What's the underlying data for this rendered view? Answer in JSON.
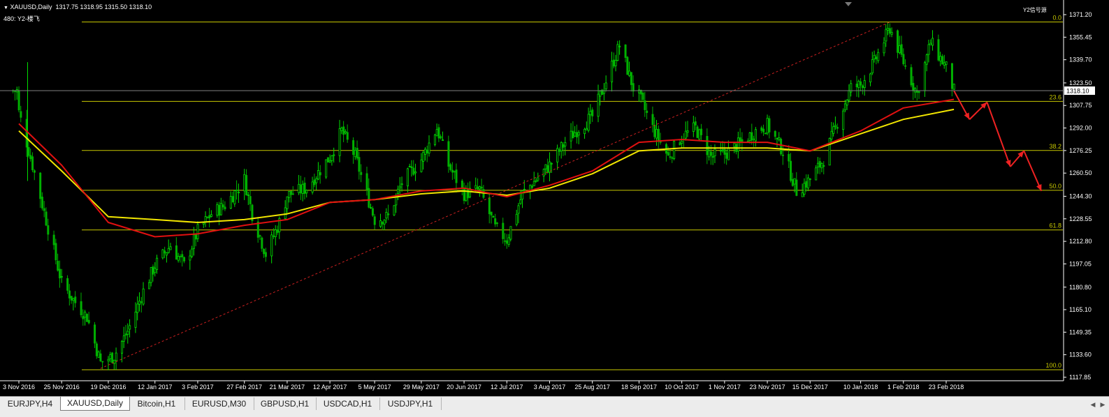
{
  "header": {
    "symbol": "XAUUSD,Daily",
    "ohlc": "1317.75 1318.95 1315.50 1318.10",
    "indicator": "480: Y2-楼飞",
    "signal_label": "Y2信号源"
  },
  "tabs": [
    {
      "label": "EURJPY,H4",
      "active": false
    },
    {
      "label": "XAUUSD,Daily",
      "active": true
    },
    {
      "label": "Bitcoin,H1",
      "active": false
    },
    {
      "label": "EURUSD,M30",
      "active": false
    },
    {
      "label": "GBPUSD,H1",
      "active": false
    },
    {
      "label": "USDCAD,H1",
      "active": false
    },
    {
      "label": "USDJPY,H1",
      "active": false
    }
  ],
  "chart_data": {
    "type": "candlestick",
    "symbol": "XAUUSD",
    "timeframe": "Daily",
    "current_price": "1318.10",
    "y_ticks": [
      "1371.20",
      "1355.45",
      "1339.70",
      "1323.50",
      "1307.75",
      "1292.00",
      "1276.25",
      "1260.50",
      "1244.30",
      "1228.55",
      "1212.80",
      "1197.05",
      "1180.80",
      "1165.10",
      "1149.35",
      "1133.60",
      "1117.85"
    ],
    "ylim": [
      1117.85,
      1371.2
    ],
    "x_ticks": [
      "3 Nov 2016",
      "25 Nov 2016",
      "19 Dec 2016",
      "12 Jan 2017",
      "3 Feb 2017",
      "27 Feb 2017",
      "21 Mar 2017",
      "12 Apr 2017",
      "5 May 2017",
      "29 May 2017",
      "20 Jun 2017",
      "12 Jul 2017",
      "3 Aug 2017",
      "25 Aug 2017",
      "18 Sep 2017",
      "10 Oct 2017",
      "1 Nov 2017",
      "23 Nov 2017",
      "15 Dec 2017",
      "10 Jan 2018",
      "1 Feb 2018",
      "23 Feb 2018"
    ],
    "fib_levels": [
      {
        "label": "0.0",
        "price": 1366.1
      },
      {
        "label": "23.6",
        "price": 1310.6
      },
      {
        "label": "38.2",
        "price": 1276.3
      },
      {
        "label": "50.0",
        "price": 1248.5
      },
      {
        "label": "61.8",
        "price": 1220.8
      },
      {
        "label": "100.0",
        "price": 1123.1
      }
    ],
    "trendline": {
      "from": {
        "date": "15 Dec 2016",
        "price": 1124
      },
      "to": {
        "date": "25 Jan 2018",
        "price": 1366
      }
    },
    "close_path": [
      [
        "3 Nov 2016",
        1303
      ],
      [
        "10 Nov 2016",
        1266
      ],
      [
        "25 Nov 2016",
        1184
      ],
      [
        "1 Dec 2016",
        1172
      ],
      [
        "8 Dec 2016",
        1160
      ],
      [
        "15 Dec 2016",
        1128
      ],
      [
        "22 Dec 2016",
        1133
      ],
      [
        "29 Dec 2016",
        1150
      ],
      [
        "6 Jan 2017",
        1178
      ],
      [
        "12 Jan 2017",
        1196
      ],
      [
        "20 Jan 2017",
        1210
      ],
      [
        "27 Jan 2017",
        1196
      ],
      [
        "3 Feb 2017",
        1220
      ],
      [
        "10 Feb 2017",
        1232
      ],
      [
        "17 Feb 2017",
        1238
      ],
      [
        "27 Feb 2017",
        1256
      ],
      [
        "3 Mar 2017",
        1232
      ],
      [
        "10 Mar 2017",
        1204
      ],
      [
        "17 Mar 2017",
        1226
      ],
      [
        "21 Mar 2017",
        1245
      ],
      [
        "31 Mar 2017",
        1250
      ],
      [
        "12 Apr 2017",
        1272
      ],
      [
        "18 Apr 2017",
        1290
      ],
      [
        "25 Apr 2017",
        1272
      ],
      [
        "5 May 2017",
        1228
      ],
      [
        "12 May 2017",
        1230
      ],
      [
        "19 May 2017",
        1254
      ],
      [
        "29 May 2017",
        1270
      ],
      [
        "6 Jun 2017",
        1292
      ],
      [
        "12 Jun 2017",
        1266
      ],
      [
        "20 Jun 2017",
        1246
      ],
      [
        "28 Jun 2017",
        1249
      ],
      [
        "6 Jul 2017",
        1222
      ],
      [
        "12 Jul 2017",
        1214
      ],
      [
        "20 Jul 2017",
        1246
      ],
      [
        "3 Aug 2017",
        1266
      ],
      [
        "11 Aug 2017",
        1282
      ],
      [
        "18 Aug 2017",
        1292
      ],
      [
        "25 Aug 2017",
        1300
      ],
      [
        "1 Sep 2017",
        1325
      ],
      [
        "8 Sep 2017",
        1350
      ],
      [
        "15 Sep 2017",
        1320
      ],
      [
        "18 Sep 2017",
        1314
      ],
      [
        "25 Sep 2017",
        1292
      ],
      [
        "3 Oct 2017",
        1272
      ],
      [
        "10 Oct 2017",
        1286
      ],
      [
        "17 Oct 2017",
        1292
      ],
      [
        "25 Oct 2017",
        1272
      ],
      [
        "1 Nov 2017",
        1274
      ],
      [
        "10 Nov 2017",
        1282
      ],
      [
        "17 Nov 2017",
        1290
      ],
      [
        "23 Nov 2017",
        1294
      ],
      [
        "1 Dec 2017",
        1276
      ],
      [
        "8 Dec 2017",
        1248
      ],
      [
        "15 Dec 2017",
        1256
      ],
      [
        "22 Dec 2017",
        1270
      ],
      [
        "29 Dec 2017",
        1296
      ],
      [
        "5 Jan 2018",
        1320
      ],
      [
        "10 Jan 2018",
        1322
      ],
      [
        "17 Jan 2018",
        1338
      ],
      [
        "25 Jan 2018",
        1362
      ],
      [
        "1 Feb 2018",
        1338
      ],
      [
        "8 Feb 2018",
        1316
      ],
      [
        "15 Feb 2018",
        1352
      ],
      [
        "23 Feb 2018",
        1334
      ],
      [
        "27 Feb 2018",
        1318
      ]
    ],
    "ma_red": [
      [
        "3 Nov 2016",
        1295
      ],
      [
        "25 Nov 2016",
        1266
      ],
      [
        "19 Dec 2016",
        1226
      ],
      [
        "12 Jan 2017",
        1216
      ],
      [
        "3 Feb 2017",
        1218
      ],
      [
        "27 Feb 2017",
        1224
      ],
      [
        "21 Mar 2017",
        1228
      ],
      [
        "12 Apr 2017",
        1240
      ],
      [
        "5 May 2017",
        1242
      ],
      [
        "29 May 2017",
        1248
      ],
      [
        "20 Jun 2017",
        1250
      ],
      [
        "12 Jul 2017",
        1244
      ],
      [
        "3 Aug 2017",
        1252
      ],
      [
        "25 Aug 2017",
        1262
      ],
      [
        "18 Sep 2017",
        1282
      ],
      [
        "10 Oct 2017",
        1284
      ],
      [
        "1 Nov 2017",
        1282
      ],
      [
        "23 Nov 2017",
        1282
      ],
      [
        "15 Dec 2017",
        1276
      ],
      [
        "10 Jan 2018",
        1290
      ],
      [
        "1 Feb 2018",
        1306
      ],
      [
        "27 Feb 2018",
        1312
      ]
    ],
    "ma_yellow": [
      [
        "3 Nov 2016",
        1290
      ],
      [
        "25 Nov 2016",
        1262
      ],
      [
        "19 Dec 2016",
        1230
      ],
      [
        "12 Jan 2017",
        1228
      ],
      [
        "3 Feb 2017",
        1226
      ],
      [
        "27 Feb 2017",
        1228
      ],
      [
        "21 Mar 2017",
        1232
      ],
      [
        "12 Apr 2017",
        1240
      ],
      [
        "5 May 2017",
        1242
      ],
      [
        "29 May 2017",
        1246
      ],
      [
        "20 Jun 2017",
        1248
      ],
      [
        "12 Jul 2017",
        1245
      ],
      [
        "3 Aug 2017",
        1250
      ],
      [
        "25 Aug 2017",
        1260
      ],
      [
        "18 Sep 2017",
        1276
      ],
      [
        "10 Oct 2017",
        1278
      ],
      [
        "1 Nov 2017",
        1278
      ],
      [
        "23 Nov 2017",
        1278
      ],
      [
        "15 Dec 2017",
        1276
      ],
      [
        "10 Jan 2018",
        1288
      ],
      [
        "1 Feb 2018",
        1298
      ],
      [
        "27 Feb 2018",
        1305
      ]
    ],
    "forecast_path": [
      [
        "27 Feb 2018",
        1318
      ],
      [
        "7 Mar 2018",
        1298
      ],
      [
        "16 Mar 2018",
        1310
      ],
      [
        "28 Mar 2018",
        1265
      ],
      [
        "4 Apr 2018",
        1276
      ],
      [
        "13 Apr 2018",
        1248
      ]
    ],
    "colors": {
      "bull": "#00e000",
      "bear": "#00b000",
      "fib": "#c8c800",
      "ma_red": "#e01010",
      "ma_yellow": "#f2e600",
      "trend": "#cc2020",
      "forecast": "#ee2222",
      "axis_text": "#ffffff",
      "grid_line": "#7f7f7f"
    }
  }
}
